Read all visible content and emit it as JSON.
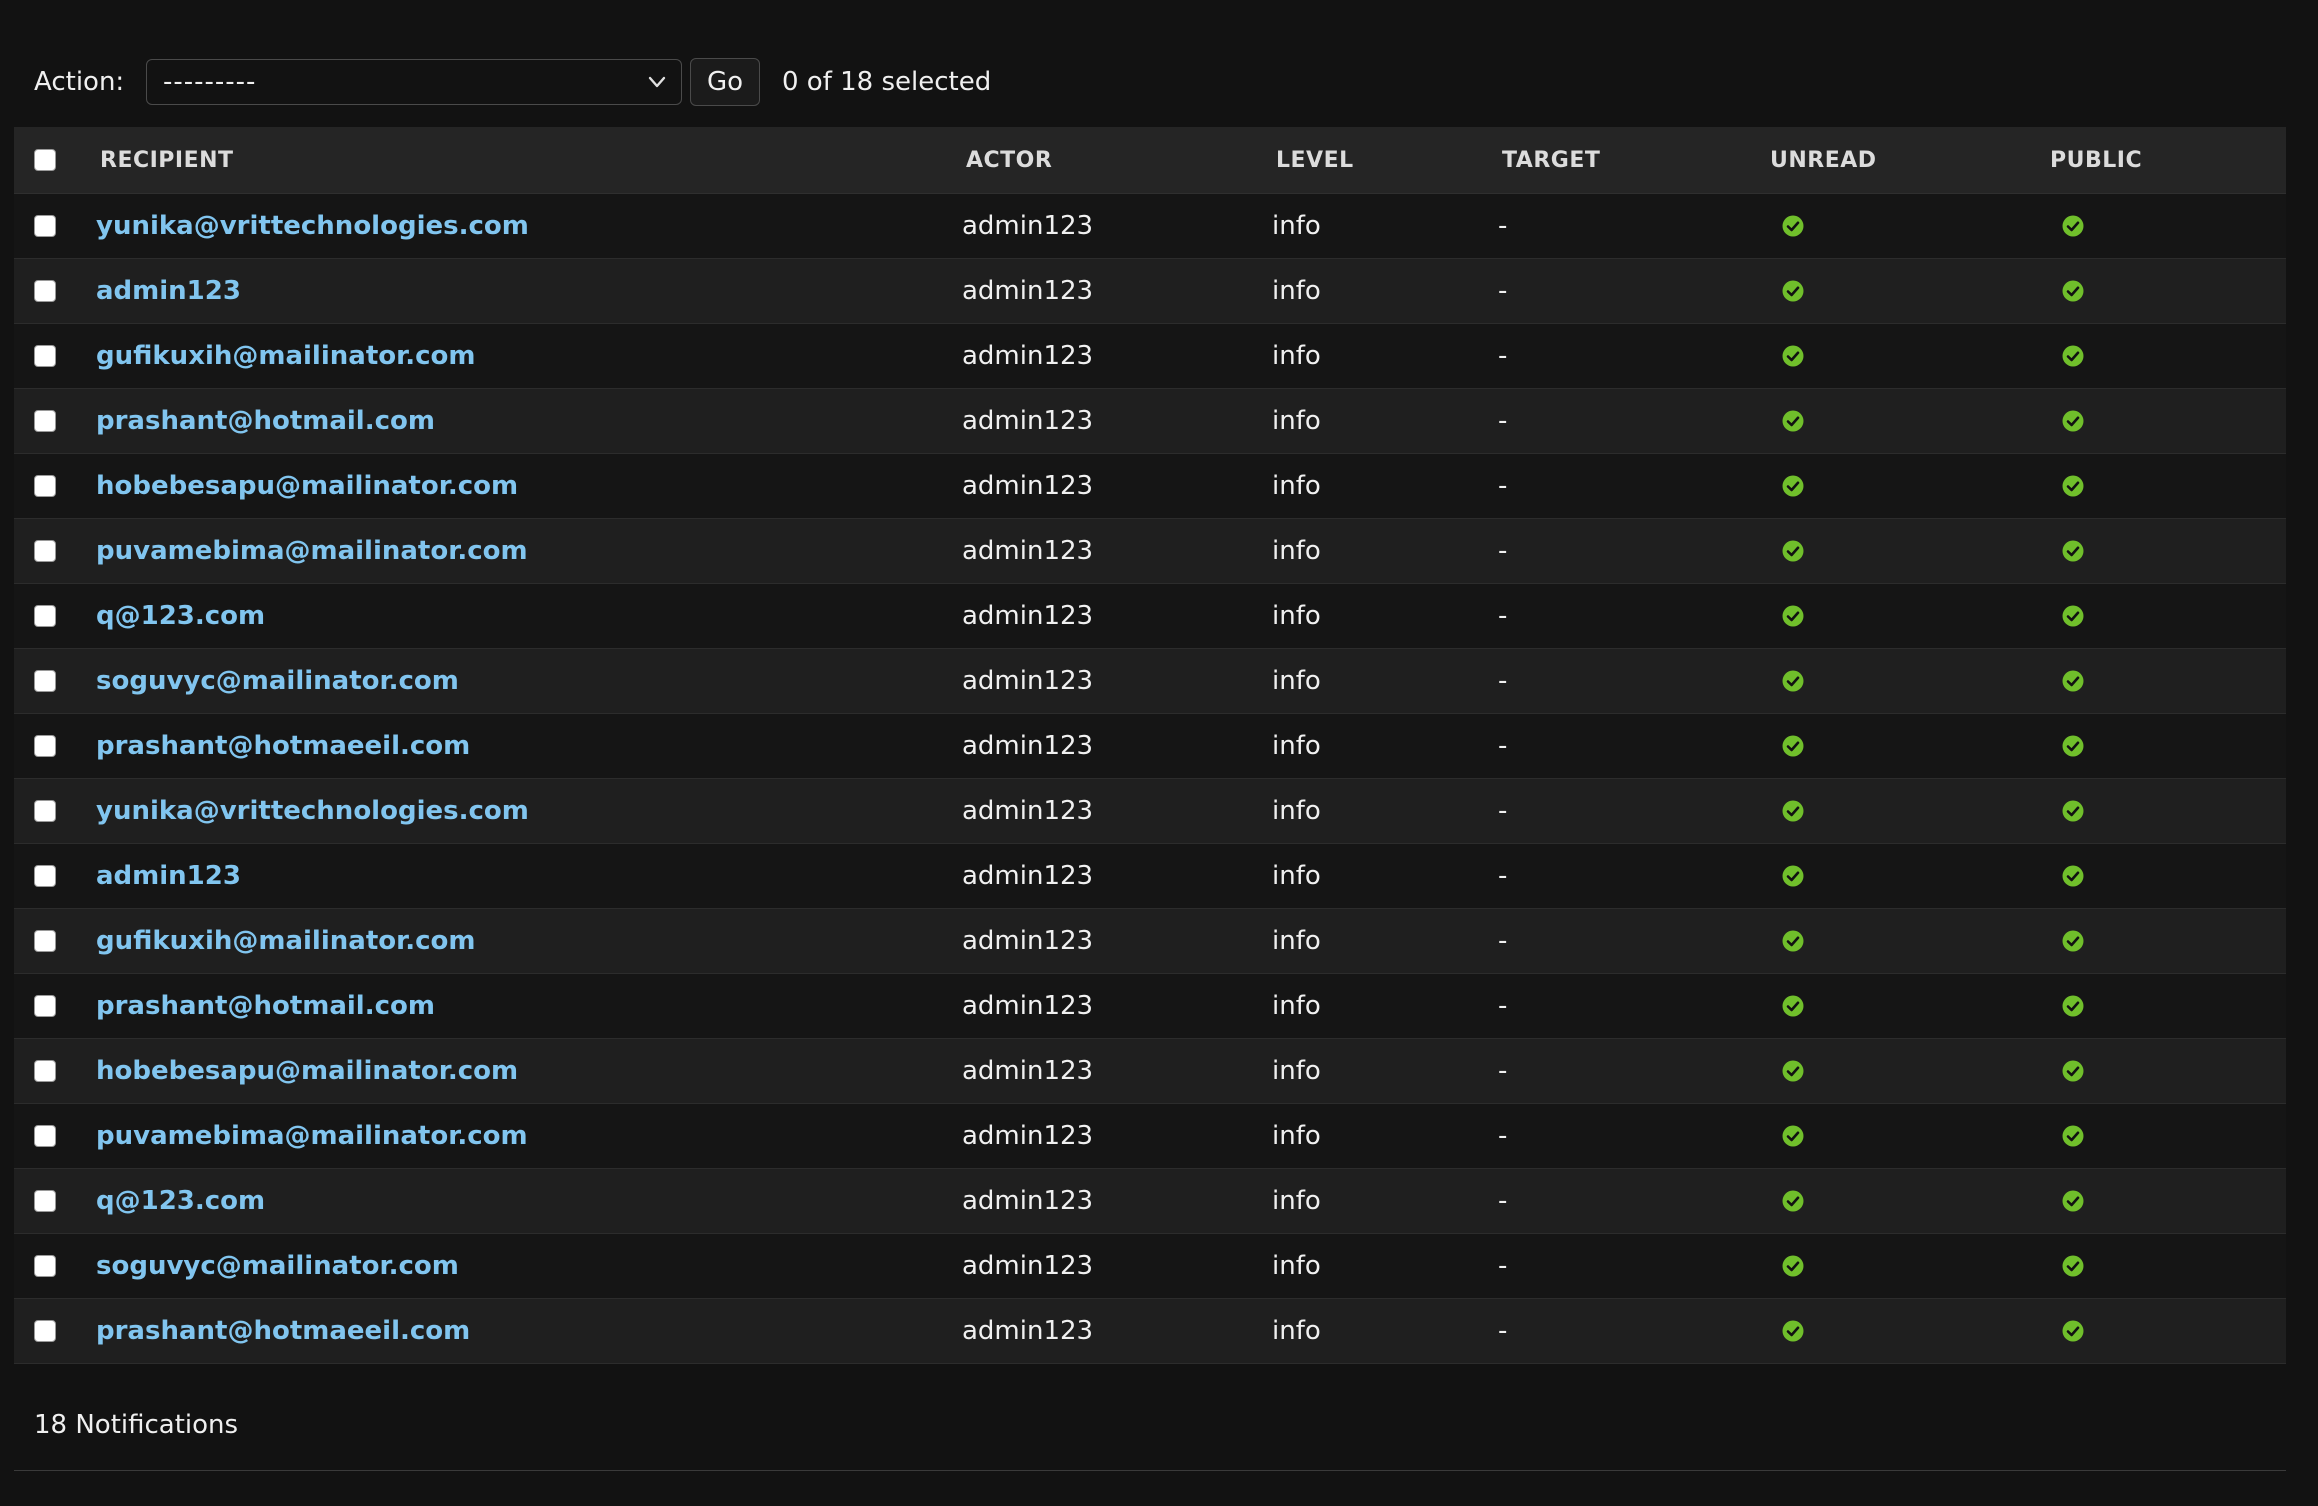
{
  "actions": {
    "label": "Action:",
    "selected_option": "---------",
    "go_label": "Go",
    "selection_status": "0 of 18 selected"
  },
  "table": {
    "headers": {
      "recipient": "RECIPIENT",
      "actor": "ACTOR",
      "level": "LEVEL",
      "target": "TARGET",
      "unread": "UNREAD",
      "public": "PUBLIC"
    },
    "rows": [
      {
        "recipient": "yunika@vrittechnologies.com",
        "actor": "admin123",
        "level": "info",
        "target": "-",
        "unread": true,
        "public": true
      },
      {
        "recipient": "admin123",
        "actor": "admin123",
        "level": "info",
        "target": "-",
        "unread": true,
        "public": true
      },
      {
        "recipient": "gufikuxih@mailinator.com",
        "actor": "admin123",
        "level": "info",
        "target": "-",
        "unread": true,
        "public": true
      },
      {
        "recipient": "prashant@hotmail.com",
        "actor": "admin123",
        "level": "info",
        "target": "-",
        "unread": true,
        "public": true
      },
      {
        "recipient": "hobebesapu@mailinator.com",
        "actor": "admin123",
        "level": "info",
        "target": "-",
        "unread": true,
        "public": true
      },
      {
        "recipient": "puvamebima@mailinator.com",
        "actor": "admin123",
        "level": "info",
        "target": "-",
        "unread": true,
        "public": true
      },
      {
        "recipient": "q@123.com",
        "actor": "admin123",
        "level": "info",
        "target": "-",
        "unread": true,
        "public": true
      },
      {
        "recipient": "soguvyc@mailinator.com",
        "actor": "admin123",
        "level": "info",
        "target": "-",
        "unread": true,
        "public": true
      },
      {
        "recipient": "prashant@hotmaeeil.com",
        "actor": "admin123",
        "level": "info",
        "target": "-",
        "unread": true,
        "public": true
      },
      {
        "recipient": "yunika@vrittechnologies.com",
        "actor": "admin123",
        "level": "info",
        "target": "-",
        "unread": true,
        "public": true
      },
      {
        "recipient": "admin123",
        "actor": "admin123",
        "level": "info",
        "target": "-",
        "unread": true,
        "public": true
      },
      {
        "recipient": "gufikuxih@mailinator.com",
        "actor": "admin123",
        "level": "info",
        "target": "-",
        "unread": true,
        "public": true
      },
      {
        "recipient": "prashant@hotmail.com",
        "actor": "admin123",
        "level": "info",
        "target": "-",
        "unread": true,
        "public": true
      },
      {
        "recipient": "hobebesapu@mailinator.com",
        "actor": "admin123",
        "level": "info",
        "target": "-",
        "unread": true,
        "public": true
      },
      {
        "recipient": "puvamebima@mailinator.com",
        "actor": "admin123",
        "level": "info",
        "target": "-",
        "unread": true,
        "public": true
      },
      {
        "recipient": "q@123.com",
        "actor": "admin123",
        "level": "info",
        "target": "-",
        "unread": true,
        "public": true
      },
      {
        "recipient": "soguvyc@mailinator.com",
        "actor": "admin123",
        "level": "info",
        "target": "-",
        "unread": true,
        "public": true
      },
      {
        "recipient": "prashant@hotmaeeil.com",
        "actor": "admin123",
        "level": "info",
        "target": "-",
        "unread": true,
        "public": true
      }
    ]
  },
  "footer": {
    "count_text": "18 Notifications"
  },
  "colors": {
    "link": "#81c5ef",
    "yes_icon": "#70bf2b",
    "background": "#121212"
  },
  "icons": {
    "boolean_true": "check-circle-icon",
    "select_chevron": "chevron-down-icon"
  }
}
